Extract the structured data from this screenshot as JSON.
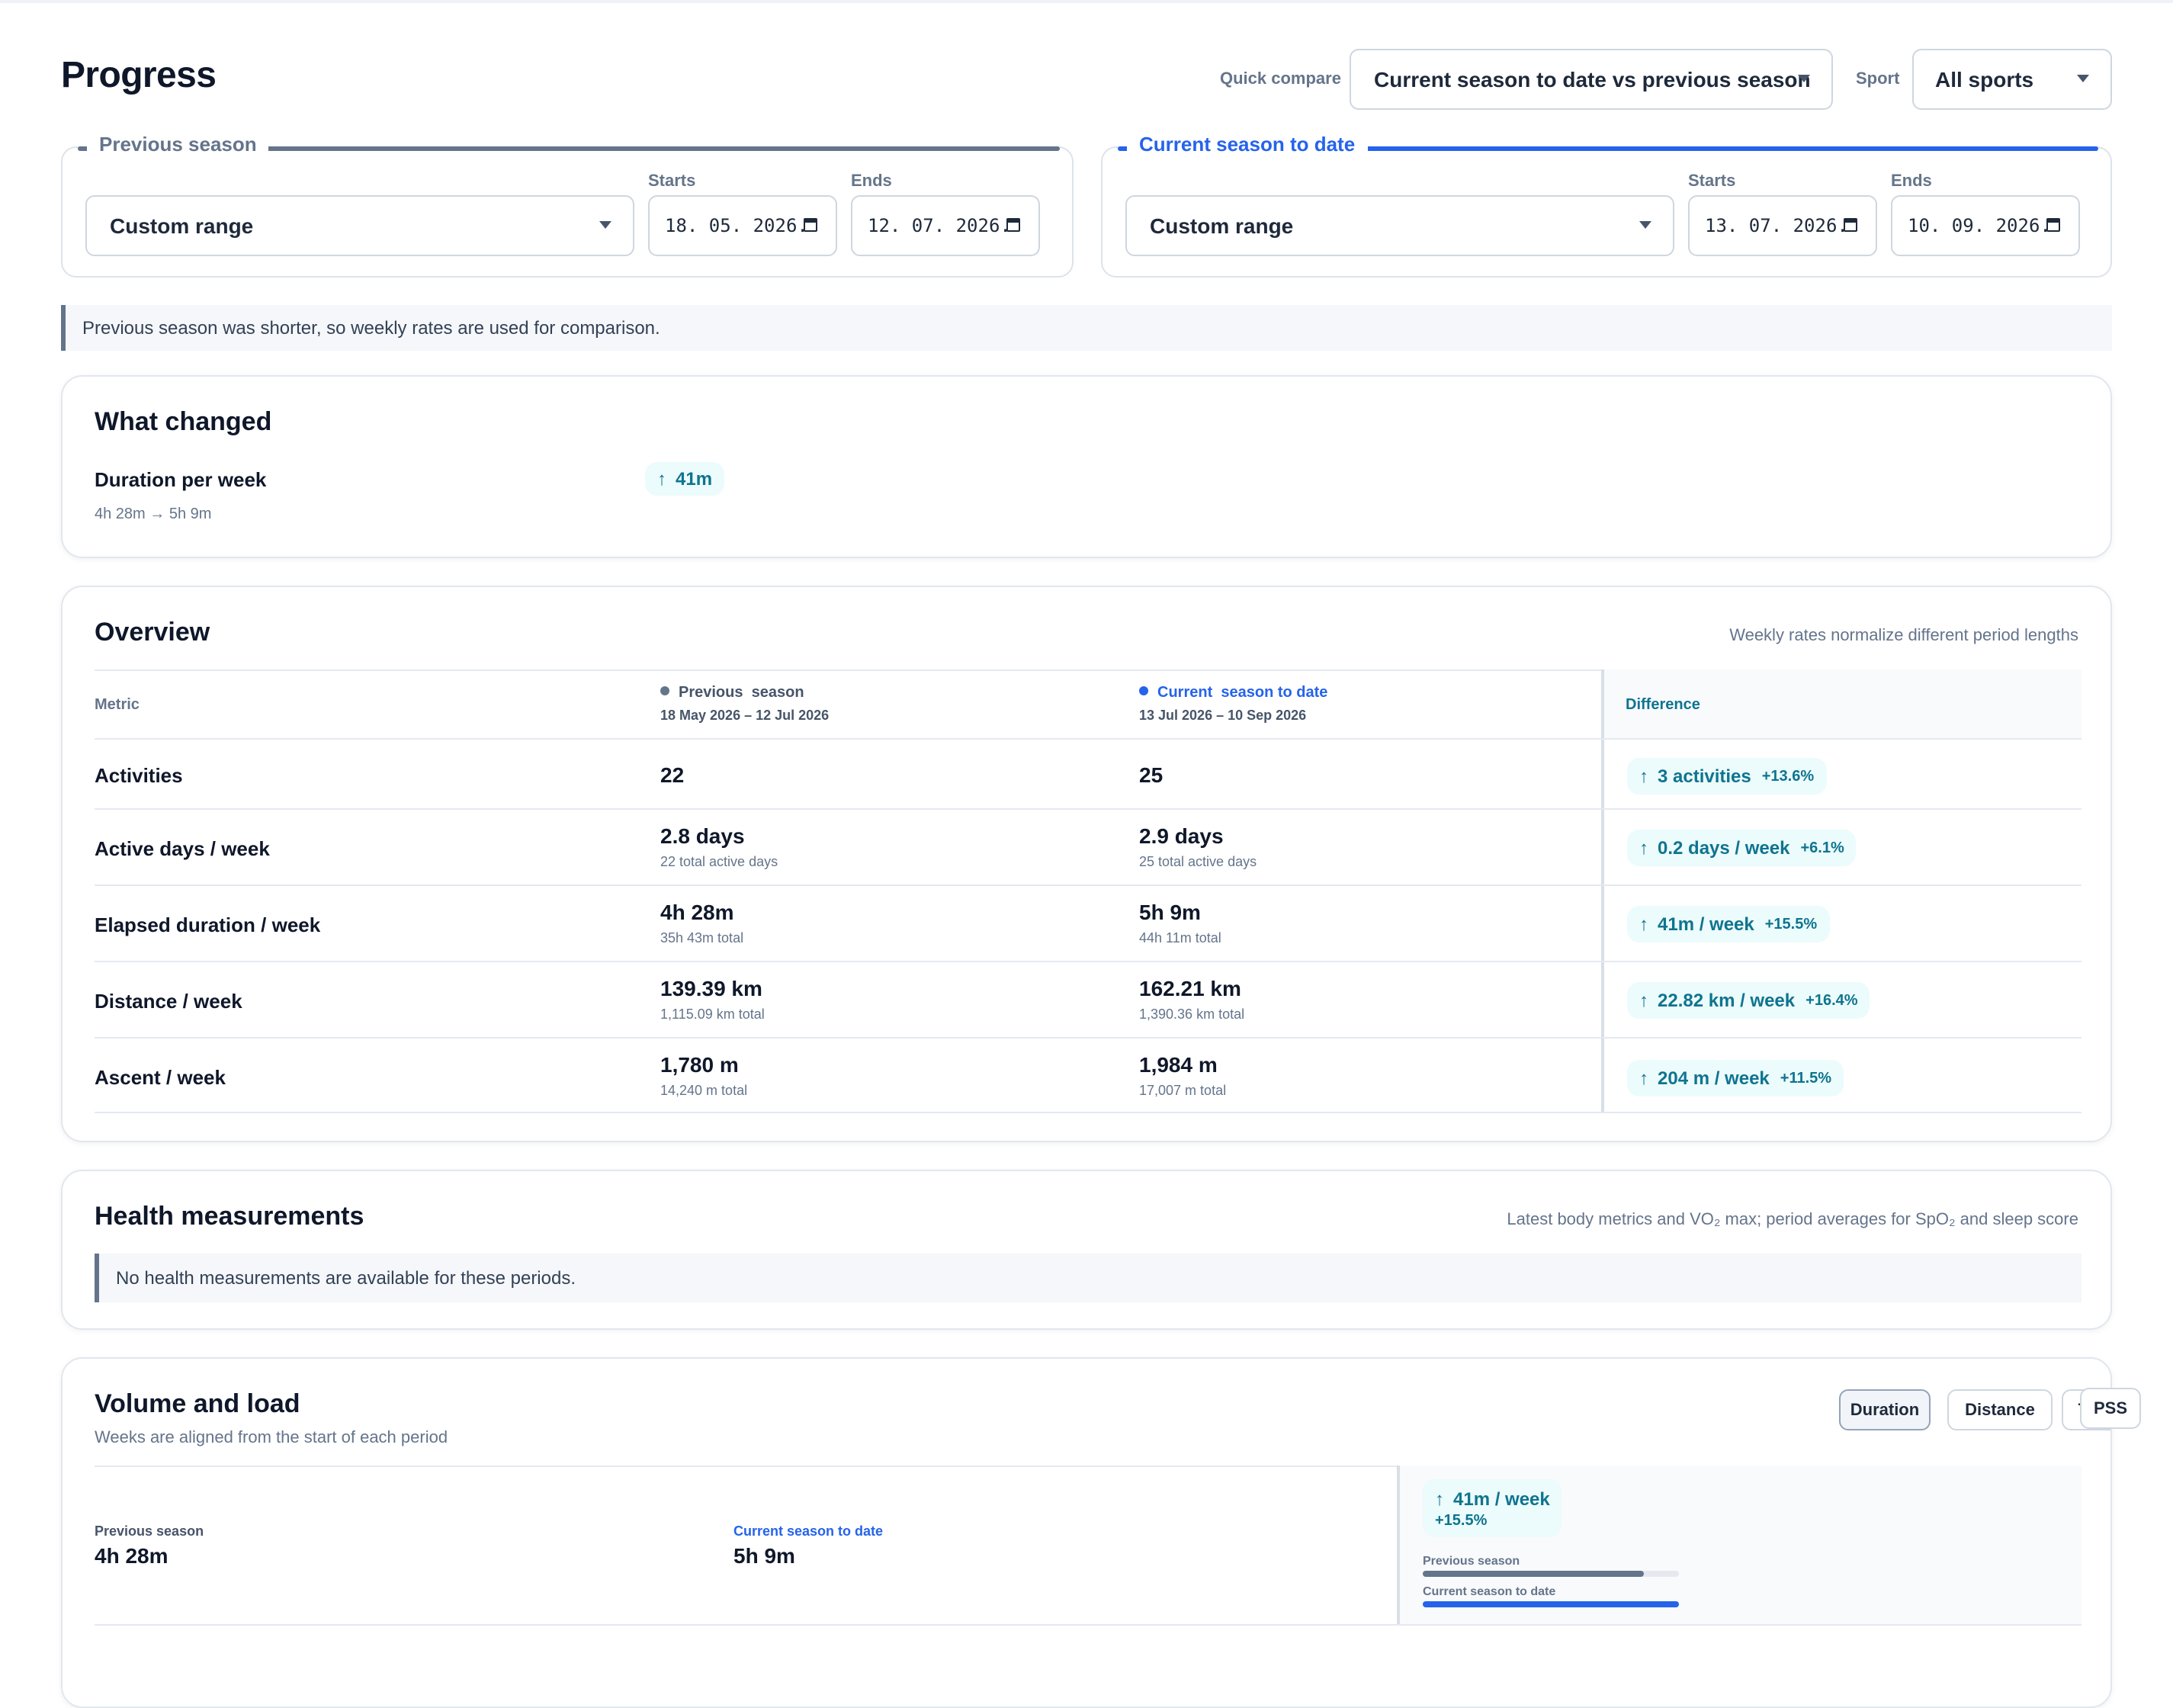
{
  "page": {
    "title": "Progress"
  },
  "filters": {
    "quick_compare_label": "Quick compare",
    "quick_compare_value": "Current season to date vs previous season",
    "sport_label": "Sport",
    "sport_value": "All sports"
  },
  "periods": {
    "previous": {
      "legend": "Previous season",
      "range_value": "Custom range",
      "starts_label": "Starts",
      "starts_value": "18. 05. 2026.",
      "ends_label": "Ends",
      "ends_value": "12. 07. 2026."
    },
    "current": {
      "legend": "Current season to date",
      "range_value": "Custom range",
      "starts_label": "Starts",
      "starts_value": "13. 07. 2026.",
      "ends_label": "Ends",
      "ends_value": "10. 09. 2026."
    }
  },
  "notice": "Previous season was shorter, so weekly rates are used for comparison.",
  "what_changed": {
    "title": "What changed",
    "item_label": "Duration per week",
    "item_detail": "4h 28m → 5h 9m",
    "item_delta": "41m"
  },
  "overview": {
    "title": "Overview",
    "note": "Weekly rates normalize different period lengths",
    "headers": {
      "metric": "Metric",
      "previous_a": "Previous",
      "previous_b": "season",
      "previous_dates": "18 May 2026 – 12 Jul 2026",
      "current_a": "Current",
      "current_b": "season to date",
      "current_dates": "13 Jul 2026 – 10 Sep 2026",
      "difference": "Difference"
    },
    "rows": [
      {
        "label": "Activities",
        "prev": "22",
        "prev_sub": "",
        "curr": "25",
        "curr_sub": "",
        "delta": "3 activities",
        "pct": "+13.6%"
      },
      {
        "label": "Active days / week",
        "prev": "2.8 days",
        "prev_sub": "22 total active days",
        "curr": "2.9 days",
        "curr_sub": "25 total active days",
        "delta": "0.2 days / week",
        "pct": "+6.1%"
      },
      {
        "label": "Elapsed duration / week",
        "prev": "4h 28m",
        "prev_sub": "35h 43m total",
        "curr": "5h 9m",
        "curr_sub": "44h 11m total",
        "delta": "41m / week",
        "pct": "+15.5%"
      },
      {
        "label": "Distance / week",
        "prev": "139.39 km",
        "prev_sub": "1,115.09 km total",
        "curr": "162.21 km",
        "curr_sub": "1,390.36 km total",
        "delta": "22.82 km / week",
        "pct": "+16.4%"
      },
      {
        "label": "Ascent / week",
        "prev": "1,780 m",
        "prev_sub": "14,240 m total",
        "curr": "1,984 m",
        "curr_sub": "17,007 m total",
        "delta": "204 m / week",
        "pct": "+11.5%"
      }
    ]
  },
  "health": {
    "title": "Health measurements",
    "note": "Latest body metrics and VO₂ max; period averages for SpO₂ and sleep score",
    "empty": "No health measurements are available for these periods."
  },
  "volume": {
    "title": "Volume and load",
    "subtitle": "Weeks are aligned from the start of each period",
    "tabs": [
      "Duration",
      "Distance",
      "TRIMP",
      "PSS"
    ],
    "active_tab": "Duration",
    "prev_label": "Previous season",
    "prev_value": "4h 28m",
    "curr_label": "Current season to date",
    "curr_value": "5h 9m",
    "delta": "41m / week",
    "pct": "+15.5%",
    "bar_prev_label": "Previous season",
    "bar_curr_label": "Current season to date",
    "bar_prev_fraction": 0.866,
    "bar_curr_fraction": 1.0
  },
  "colors": {
    "accent_blue": "#2563eb",
    "previous_gray": "#64748b",
    "delta_teal": "#0e7490",
    "delta_bg": "#ecfbfb"
  }
}
